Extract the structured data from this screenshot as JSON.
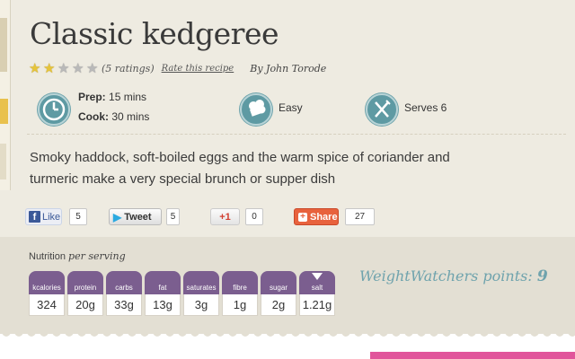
{
  "recipe": {
    "title": "Classic kedgeree",
    "rating": {
      "stars_filled": 2,
      "stars_total": 5,
      "count_text": "(5 ratings)",
      "rate_link": "Rate this recipe"
    },
    "author": "By John Torode",
    "prep_label": "Prep:",
    "prep_value": "15 mins",
    "cook_label": "Cook:",
    "cook_value": "30 mins",
    "difficulty": "Easy",
    "serves": "Serves 6",
    "description": "Smoky haddock, soft-boiled eggs and the warm spice of coriander and turmeric make a very special brunch or supper dish"
  },
  "icons": {
    "time": "clock-icon",
    "difficulty": "chef-hat-icon",
    "serves": "knife-fork-icon"
  },
  "share": {
    "facebook_label": "Like",
    "facebook_count": "5",
    "twitter_label": "Tweet",
    "twitter_count": "5",
    "google_label": "+1",
    "google_count": "0",
    "share_label": "Share",
    "share_count": "27"
  },
  "nutrition": {
    "heading": "Nutrition",
    "heading_suffix": "per serving",
    "items": [
      {
        "label": "kcalories",
        "value": "324"
      },
      {
        "label": "protein",
        "value": "20g"
      },
      {
        "label": "carbs",
        "value": "33g"
      },
      {
        "label": "fat",
        "value": "13g"
      },
      {
        "label": "saturates",
        "value": "3g"
      },
      {
        "label": "fibre",
        "value": "1g"
      },
      {
        "label": "sugar",
        "value": "2g"
      },
      {
        "label": "salt",
        "value": "1.21g"
      }
    ],
    "weightwatchers_label": "WeightWatchers points:",
    "weightwatchers_value": "9"
  },
  "colors": {
    "background": "#eeebe1",
    "nutrition_bg": "#e3dfd3",
    "nutrition_label_bg": "#7b5e8f",
    "icon_teal": "#5e9aa3",
    "weightwatchers": "#6fa3ad",
    "pink_accent": "#e1559b"
  }
}
